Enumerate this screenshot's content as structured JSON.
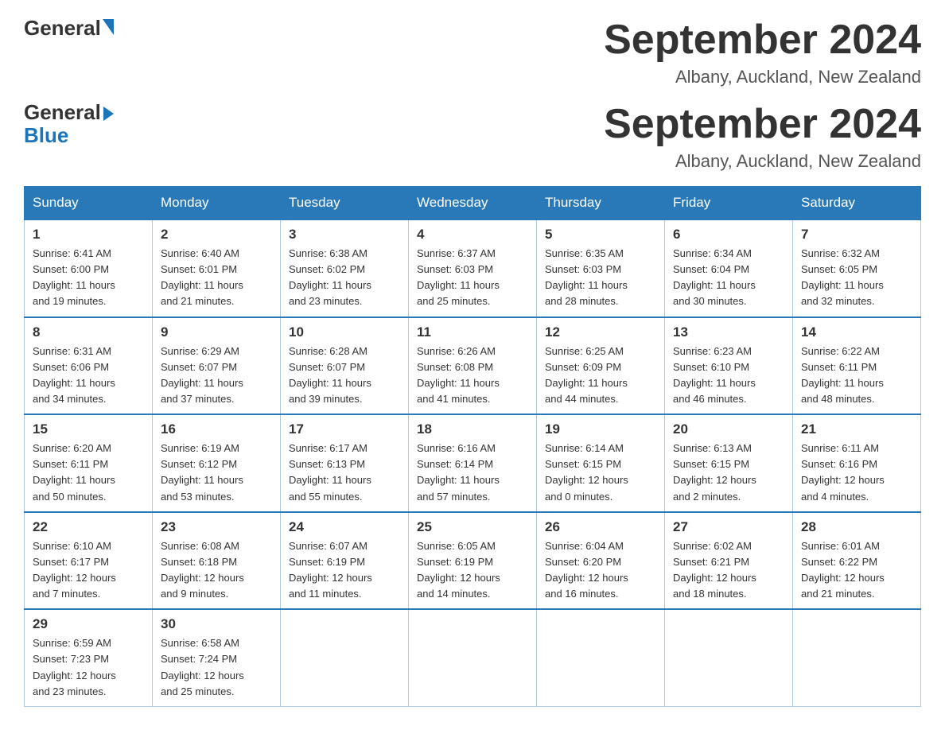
{
  "logo": {
    "general": "General",
    "blue": "Blue"
  },
  "title": "September 2024",
  "location": "Albany, Auckland, New Zealand",
  "days_of_week": [
    "Sunday",
    "Monday",
    "Tuesday",
    "Wednesday",
    "Thursday",
    "Friday",
    "Saturday"
  ],
  "weeks": [
    [
      {
        "day": "1",
        "sunrise": "6:41 AM",
        "sunset": "6:00 PM",
        "daylight": "11 hours and 19 minutes."
      },
      {
        "day": "2",
        "sunrise": "6:40 AM",
        "sunset": "6:01 PM",
        "daylight": "11 hours and 21 minutes."
      },
      {
        "day": "3",
        "sunrise": "6:38 AM",
        "sunset": "6:02 PM",
        "daylight": "11 hours and 23 minutes."
      },
      {
        "day": "4",
        "sunrise": "6:37 AM",
        "sunset": "6:03 PM",
        "daylight": "11 hours and 25 minutes."
      },
      {
        "day": "5",
        "sunrise": "6:35 AM",
        "sunset": "6:03 PM",
        "daylight": "11 hours and 28 minutes."
      },
      {
        "day": "6",
        "sunrise": "6:34 AM",
        "sunset": "6:04 PM",
        "daylight": "11 hours and 30 minutes."
      },
      {
        "day": "7",
        "sunrise": "6:32 AM",
        "sunset": "6:05 PM",
        "daylight": "11 hours and 32 minutes."
      }
    ],
    [
      {
        "day": "8",
        "sunrise": "6:31 AM",
        "sunset": "6:06 PM",
        "daylight": "11 hours and 34 minutes."
      },
      {
        "day": "9",
        "sunrise": "6:29 AM",
        "sunset": "6:07 PM",
        "daylight": "11 hours and 37 minutes."
      },
      {
        "day": "10",
        "sunrise": "6:28 AM",
        "sunset": "6:07 PM",
        "daylight": "11 hours and 39 minutes."
      },
      {
        "day": "11",
        "sunrise": "6:26 AM",
        "sunset": "6:08 PM",
        "daylight": "11 hours and 41 minutes."
      },
      {
        "day": "12",
        "sunrise": "6:25 AM",
        "sunset": "6:09 PM",
        "daylight": "11 hours and 44 minutes."
      },
      {
        "day": "13",
        "sunrise": "6:23 AM",
        "sunset": "6:10 PM",
        "daylight": "11 hours and 46 minutes."
      },
      {
        "day": "14",
        "sunrise": "6:22 AM",
        "sunset": "6:11 PM",
        "daylight": "11 hours and 48 minutes."
      }
    ],
    [
      {
        "day": "15",
        "sunrise": "6:20 AM",
        "sunset": "6:11 PM",
        "daylight": "11 hours and 50 minutes."
      },
      {
        "day": "16",
        "sunrise": "6:19 AM",
        "sunset": "6:12 PM",
        "daylight": "11 hours and 53 minutes."
      },
      {
        "day": "17",
        "sunrise": "6:17 AM",
        "sunset": "6:13 PM",
        "daylight": "11 hours and 55 minutes."
      },
      {
        "day": "18",
        "sunrise": "6:16 AM",
        "sunset": "6:14 PM",
        "daylight": "11 hours and 57 minutes."
      },
      {
        "day": "19",
        "sunrise": "6:14 AM",
        "sunset": "6:15 PM",
        "daylight": "12 hours and 0 minutes."
      },
      {
        "day": "20",
        "sunrise": "6:13 AM",
        "sunset": "6:15 PM",
        "daylight": "12 hours and 2 minutes."
      },
      {
        "day": "21",
        "sunrise": "6:11 AM",
        "sunset": "6:16 PM",
        "daylight": "12 hours and 4 minutes."
      }
    ],
    [
      {
        "day": "22",
        "sunrise": "6:10 AM",
        "sunset": "6:17 PM",
        "daylight": "12 hours and 7 minutes."
      },
      {
        "day": "23",
        "sunrise": "6:08 AM",
        "sunset": "6:18 PM",
        "daylight": "12 hours and 9 minutes."
      },
      {
        "day": "24",
        "sunrise": "6:07 AM",
        "sunset": "6:19 PM",
        "daylight": "12 hours and 11 minutes."
      },
      {
        "day": "25",
        "sunrise": "6:05 AM",
        "sunset": "6:19 PM",
        "daylight": "12 hours and 14 minutes."
      },
      {
        "day": "26",
        "sunrise": "6:04 AM",
        "sunset": "6:20 PM",
        "daylight": "12 hours and 16 minutes."
      },
      {
        "day": "27",
        "sunrise": "6:02 AM",
        "sunset": "6:21 PM",
        "daylight": "12 hours and 18 minutes."
      },
      {
        "day": "28",
        "sunrise": "6:01 AM",
        "sunset": "6:22 PM",
        "daylight": "12 hours and 21 minutes."
      }
    ],
    [
      {
        "day": "29",
        "sunrise": "6:59 AM",
        "sunset": "7:23 PM",
        "daylight": "12 hours and 23 minutes."
      },
      {
        "day": "30",
        "sunrise": "6:58 AM",
        "sunset": "7:24 PM",
        "daylight": "12 hours and 25 minutes."
      },
      null,
      null,
      null,
      null,
      null
    ]
  ]
}
